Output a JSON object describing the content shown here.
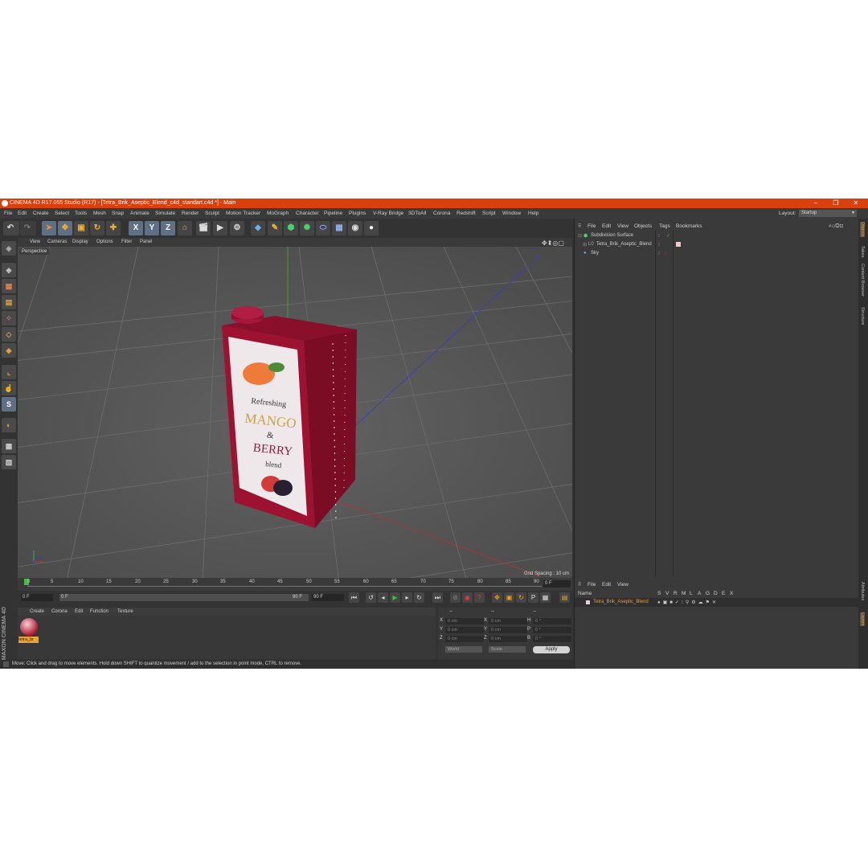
{
  "window": {
    "title": "CINEMA 4D R17.055 Studio (R17) - [Tetra_Brik_Aseptic_Blend_c4d_standart.c4d *] - Main",
    "controls": [
      "–",
      "❐",
      "✕"
    ]
  },
  "menubar": {
    "items": [
      "File",
      "Edit",
      "Create",
      "Select",
      "Tools",
      "Mesh",
      "Snap",
      "Animate",
      "Simulate",
      "Render",
      "Sculpt",
      "Motion Tracker",
      "MoGraph",
      "Character",
      "Pipeline",
      "Plugins",
      "V-Ray Bridge",
      "3DToAll",
      "Corona",
      "Redshift",
      "Script",
      "Window",
      "Help"
    ],
    "layout_label": "Layout:",
    "layout_value": "Startup"
  },
  "toolbar": {
    "axis_x": "X",
    "axis_y": "Y",
    "axis_z": "Z"
  },
  "viewport": {
    "menu": [
      "View",
      "Cameras",
      "Display",
      "Options",
      "Filter",
      "Panel"
    ],
    "label": "Perspective",
    "grid_spacing": "Grid Spacing : 10 cm",
    "product": {
      "line1": "Refreshing",
      "line2": "MANGO",
      "line3": "&",
      "line4": "BERRY",
      "line5": "blend"
    }
  },
  "timeline": {
    "ticks": [
      "0",
      "5",
      "10",
      "15",
      "20",
      "25",
      "30",
      "35",
      "40",
      "45",
      "50",
      "55",
      "60",
      "65",
      "70",
      "75",
      "80",
      "85",
      "90"
    ],
    "end_field": "0 F"
  },
  "transport": {
    "start": "0 F",
    "current": "0 F",
    "slider_end": "90 F",
    "end": "90 F"
  },
  "material_manager": {
    "menu": [
      "Create",
      "Corona",
      "Edit",
      "Function",
      "Texture"
    ],
    "material_name": "tetra_br",
    "brand": "MAXON CINEMA 4D"
  },
  "coordinates": {
    "header": [
      "--",
      "--",
      "--"
    ],
    "rows": [
      {
        "axis": "X",
        "pos": "0 cm",
        "axis2": "X",
        "size": "0 cm",
        "axis3": "H",
        "rot": "0 °"
      },
      {
        "axis": "Y",
        "pos": "0 cm",
        "axis2": "Y",
        "size": "0 cm",
        "axis3": "P",
        "rot": "0 °"
      },
      {
        "axis": "Z",
        "pos": "0 cm",
        "axis2": "Z",
        "size": "0 cm",
        "axis3": "B",
        "rot": "0 °"
      }
    ],
    "mode": "World",
    "scale": "Scale",
    "apply": "Apply"
  },
  "status": {
    "text": "Move: Click and drag to move elements. Hold down SHIFT to quantize movement / add to the selection in point mode, CTRL to remove."
  },
  "object_manager": {
    "menu": [
      "File",
      "Edit",
      "View",
      "Objects",
      "Tags",
      "Bookmarks"
    ],
    "objects": [
      "Subdivision Surface",
      "Tetra_Brik_Aseptic_Blend",
      "Sky"
    ]
  },
  "attribute_manager": {
    "menu": [
      "File",
      "Edit",
      "View"
    ],
    "columns": [
      "Name",
      "S",
      "V",
      "R",
      "M",
      "L",
      "A",
      "G",
      "D",
      "E",
      "X"
    ],
    "row_name": "Tetra_Brik_Aseptic_Blend"
  },
  "right_tabs": [
    "Objects",
    "Takes",
    "Content Browser",
    "Structure",
    "Attributes",
    "Layers"
  ],
  "colors": {
    "title_bar": "#d9400d",
    "carton_red": "#9c1230",
    "text_gold": "#c9a24a"
  }
}
